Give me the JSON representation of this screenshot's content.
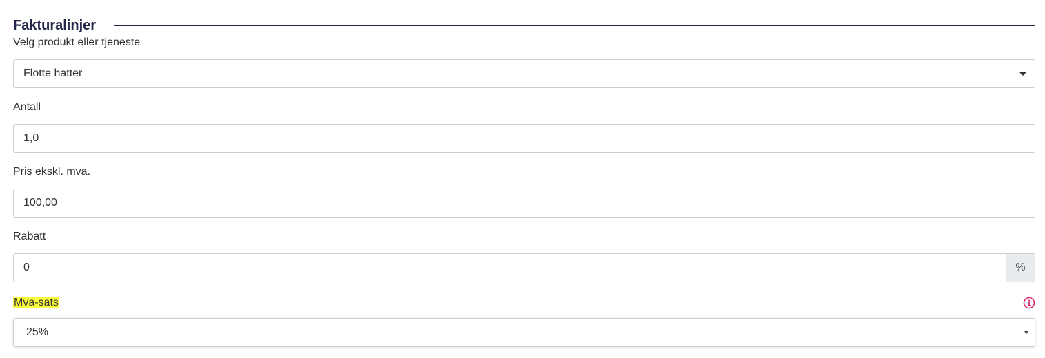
{
  "section": {
    "title": "Fakturalinjer"
  },
  "product": {
    "label": "Velg produkt eller tjeneste",
    "value": "Flotte hatter"
  },
  "quantity": {
    "label": "Antall",
    "value": "1,0"
  },
  "price": {
    "label": "Pris ekskl. mva.",
    "value": "100,00"
  },
  "discount": {
    "label": "Rabatt",
    "value": "0",
    "unit": "%"
  },
  "vat": {
    "label": "Mva-sats",
    "value": "25%",
    "info_icon": "info-circle-icon"
  },
  "colors": {
    "heading": "#23284a",
    "highlight": "#fbff3c",
    "info_icon": "#d6246e",
    "border": "#ccd0d6",
    "addon_bg": "#e9ecef"
  }
}
